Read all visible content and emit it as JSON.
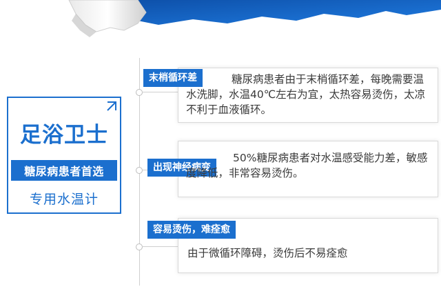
{
  "badge": {
    "title": "足浴卫士",
    "strip": "糖尿病患者首选",
    "subtitle": "专用水温计"
  },
  "items": [
    {
      "tag": "末梢循环差",
      "text": "糖尿病患者由于末梢循环差，每晚需要温水洗脚，水温40℃左右为宜，太热容易烫伤，太凉不利于血液循环。"
    },
    {
      "tag": "出现神经病变",
      "text": "50%糖尿病患者对水温感受能力差，敏感度降低，非常容易烫伤。"
    },
    {
      "tag": "容易烫伤，难痊愈",
      "text": "由于微循环障碍，烫伤后不易痊愈"
    }
  ],
  "colors": {
    "accent": "#1b6fce",
    "text": "#3a3a3a",
    "line": "#cfcfcf"
  }
}
